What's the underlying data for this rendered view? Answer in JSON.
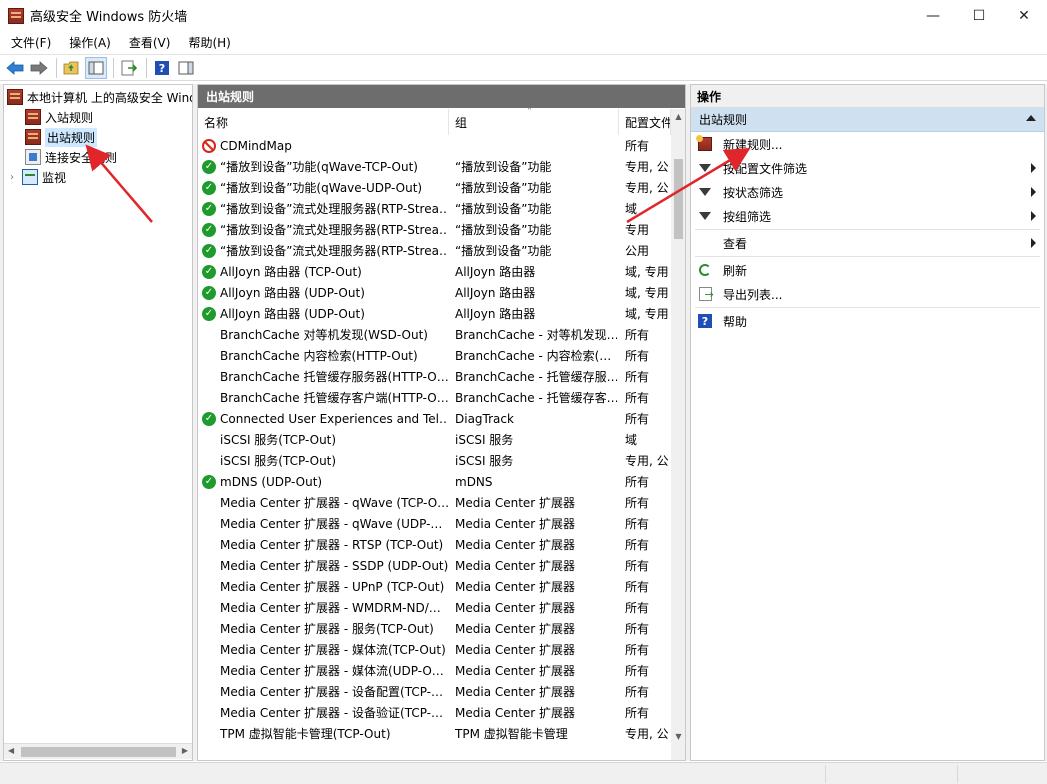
{
  "window": {
    "title": "高级安全 Windows 防火墙",
    "minimize": "—",
    "maximize": "☐",
    "close": "✕"
  },
  "menu": [
    "文件(F)",
    "操作(A)",
    "查看(V)",
    "帮助(H)"
  ],
  "toolbar": {
    "icons": [
      "back-icon",
      "forward-icon",
      "up-folder-icon",
      "show-hide-tree-icon",
      "export-icon",
      "help-icon",
      "action-pane-icon"
    ]
  },
  "tree": {
    "root": "本地计算机 上的高级安全 Windows 防火墙",
    "items": [
      {
        "label": "入站规则",
        "icon": "firewall-rule-icon"
      },
      {
        "label": "出站规则",
        "icon": "firewall-rule-icon"
      },
      {
        "label": "连接安全规则",
        "icon": "lock-icon"
      },
      {
        "label": "监视",
        "icon": "monitor-icon"
      }
    ]
  },
  "list": {
    "header": "出站规则",
    "columns": [
      "名称",
      "组",
      "配置文件"
    ],
    "rows": [
      {
        "status": "block",
        "name": "CDMindMap",
        "group": "",
        "profile": "所有"
      },
      {
        "status": "allow",
        "name": "“播放到设备”功能(qWave-TCP-Out)",
        "group": "“播放到设备”功能",
        "profile": "专用, 公"
      },
      {
        "status": "allow",
        "name": "“播放到设备”功能(qWave-UDP-Out)",
        "group": "“播放到设备”功能",
        "profile": "专用, 公"
      },
      {
        "status": "allow",
        "name": "“播放到设备”流式处理服务器(RTP-Strea…",
        "group": "“播放到设备”功能",
        "profile": "域"
      },
      {
        "status": "allow",
        "name": "“播放到设备”流式处理服务器(RTP-Strea…",
        "group": "“播放到设备”功能",
        "profile": "专用"
      },
      {
        "status": "allow",
        "name": "“播放到设备”流式处理服务器(RTP-Strea…",
        "group": "“播放到设备”功能",
        "profile": "公用"
      },
      {
        "status": "allow",
        "name": "AllJoyn 路由器 (TCP-Out)",
        "group": "AllJoyn 路由器",
        "profile": "域, 专用"
      },
      {
        "status": "allow",
        "name": "AllJoyn 路由器 (UDP-Out)",
        "group": "AllJoyn 路由器",
        "profile": "域, 专用"
      },
      {
        "status": "allow",
        "name": "AllJoyn 路由器 (UDP-Out)",
        "group": "AllJoyn 路由器",
        "profile": "域, 专用"
      },
      {
        "status": "none",
        "name": "BranchCache 对等机发现(WSD-Out)",
        "group": "BranchCache - 对等机发现…",
        "profile": "所有"
      },
      {
        "status": "none",
        "name": "BranchCache 内容检索(HTTP-Out)",
        "group": "BranchCache - 内容检索(…",
        "profile": "所有"
      },
      {
        "status": "none",
        "name": "BranchCache 托管缓存服务器(HTTP-O…",
        "group": "BranchCache - 托管缓存服…",
        "profile": "所有"
      },
      {
        "status": "none",
        "name": "BranchCache 托管缓存客户端(HTTP-O…",
        "group": "BranchCache - 托管缓存客…",
        "profile": "所有"
      },
      {
        "status": "allow",
        "name": "Connected User Experiences and Tel…",
        "group": "DiagTrack",
        "profile": "所有"
      },
      {
        "status": "none",
        "name": "iSCSI 服务(TCP-Out)",
        "group": "iSCSI 服务",
        "profile": "域"
      },
      {
        "status": "none",
        "name": "iSCSI 服务(TCP-Out)",
        "group": "iSCSI 服务",
        "profile": "专用, 公"
      },
      {
        "status": "allow",
        "name": "mDNS (UDP-Out)",
        "group": "mDNS",
        "profile": "所有"
      },
      {
        "status": "none",
        "name": "Media Center 扩展器 - qWave (TCP-O…",
        "group": "Media Center 扩展器",
        "profile": "所有"
      },
      {
        "status": "none",
        "name": "Media Center 扩展器 - qWave (UDP-…",
        "group": "Media Center 扩展器",
        "profile": "所有"
      },
      {
        "status": "none",
        "name": "Media Center 扩展器 - RTSP (TCP-Out)",
        "group": "Media Center 扩展器",
        "profile": "所有"
      },
      {
        "status": "none",
        "name": "Media Center 扩展器 - SSDP (UDP-Out)",
        "group": "Media Center 扩展器",
        "profile": "所有"
      },
      {
        "status": "none",
        "name": "Media Center 扩展器 - UPnP (TCP-Out)",
        "group": "Media Center 扩展器",
        "profile": "所有"
      },
      {
        "status": "none",
        "name": "Media Center 扩展器 - WMDRM-ND/…",
        "group": "Media Center 扩展器",
        "profile": "所有"
      },
      {
        "status": "none",
        "name": "Media Center 扩展器 - 服务(TCP-Out)",
        "group": "Media Center 扩展器",
        "profile": "所有"
      },
      {
        "status": "none",
        "name": "Media Center 扩展器 - 媒体流(TCP-Out)",
        "group": "Media Center 扩展器",
        "profile": "所有"
      },
      {
        "status": "none",
        "name": "Media Center 扩展器 - 媒体流(UDP-O…",
        "group": "Media Center 扩展器",
        "profile": "所有"
      },
      {
        "status": "none",
        "name": "Media Center 扩展器 - 设备配置(TCP-…",
        "group": "Media Center 扩展器",
        "profile": "所有"
      },
      {
        "status": "none",
        "name": "Media Center 扩展器 - 设备验证(TCP-…",
        "group": "Media Center 扩展器",
        "profile": "所有"
      },
      {
        "status": "none",
        "name": "TPM 虚拟智能卡管理(TCP-Out)",
        "group": "TPM 虚拟智能卡管理",
        "profile": "专用, 公"
      }
    ]
  },
  "actions": {
    "header": "操作",
    "section": "出站规则",
    "items": [
      {
        "label": "新建规则...",
        "icon": "new-rule-icon",
        "submenu": false
      },
      {
        "label": "按配置文件筛选",
        "icon": "filter-icon",
        "submenu": true
      },
      {
        "label": "按状态筛选",
        "icon": "filter-icon",
        "submenu": true
      },
      {
        "label": "按组筛选",
        "icon": "filter-icon",
        "submenu": true
      },
      {
        "label": "查看",
        "icon": "",
        "submenu": true
      },
      {
        "label": "刷新",
        "icon": "refresh-icon",
        "submenu": false
      },
      {
        "label": "导出列表...",
        "icon": "export-icon",
        "submenu": false
      },
      {
        "label": "帮助",
        "icon": "help-icon",
        "submenu": false
      }
    ]
  },
  "colors": {
    "pane_header_bg": "#6d6d6d",
    "action_section_bg": "#cfe0f1",
    "selection_bg": "#cde8ff",
    "allow_green": "#1e9b2c",
    "block_red": "#d8261b",
    "annotation_arrow": "#e0262a"
  }
}
